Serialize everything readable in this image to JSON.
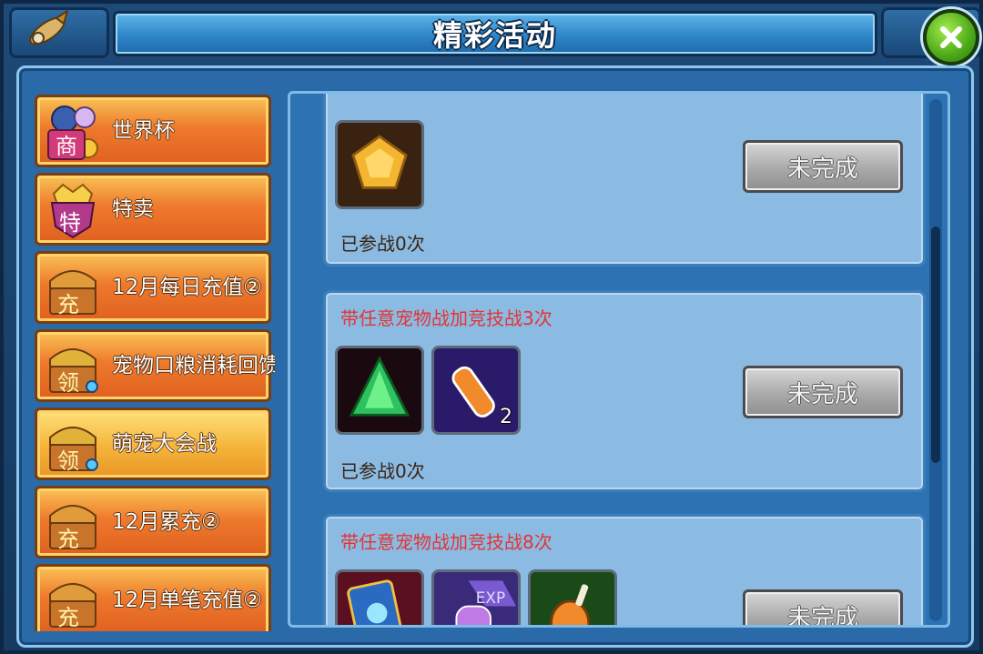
{
  "window": {
    "title": "精彩活动"
  },
  "sidebar": {
    "items": [
      {
        "label": "世界杯",
        "badge": "商",
        "icon": "shop-ball-icon",
        "selected": false
      },
      {
        "label": "特卖",
        "badge": "特",
        "icon": "crown-shield-icon",
        "selected": false
      },
      {
        "label": "12月每日充值②",
        "badge": "充",
        "icon": "treasure-chest-icon",
        "selected": false
      },
      {
        "label": "宠物口粮消耗回馈",
        "badge": "领",
        "icon": "gem-chest-icon",
        "selected": false
      },
      {
        "label": "萌宠大会战",
        "badge": "领",
        "icon": "gem-chest-icon",
        "selected": true
      },
      {
        "label": "12月累充②",
        "badge": "充",
        "icon": "treasure-chest-icon",
        "selected": false
      },
      {
        "label": "12月单笔充值②",
        "badge": "充",
        "icon": "treasure-chest-icon",
        "selected": false
      }
    ]
  },
  "tasks": [
    {
      "title": "",
      "rewards": [
        {
          "icon": "gold-pentagon-gem-icon",
          "qty": ""
        }
      ],
      "progress": "已参战0次",
      "status": "未完成"
    },
    {
      "title": "带任意宠物战加竞技战3次",
      "rewards": [
        {
          "icon": "green-crystal-icon",
          "qty": ""
        },
        {
          "icon": "potion-vial-icon",
          "qty": "2"
        }
      ],
      "progress": "已参战0次",
      "status": "未完成"
    },
    {
      "title": "带任意宠物战加竞技战8次",
      "rewards": [
        {
          "icon": "skill-card-icon",
          "qty": ""
        },
        {
          "icon": "exp-potion-icon",
          "qty": ""
        },
        {
          "icon": "meat-drumstick-icon",
          "qty": ""
        }
      ],
      "progress": "",
      "status": "未完成"
    }
  ],
  "colors": {
    "task_title": "#e53434",
    "sidebar_item": "#ee7a2d",
    "card_bg": "#8bbbe2",
    "status_button": "#a9a9a9"
  },
  "icons": {
    "close": "close-icon",
    "top_left": "rocket-icon"
  }
}
